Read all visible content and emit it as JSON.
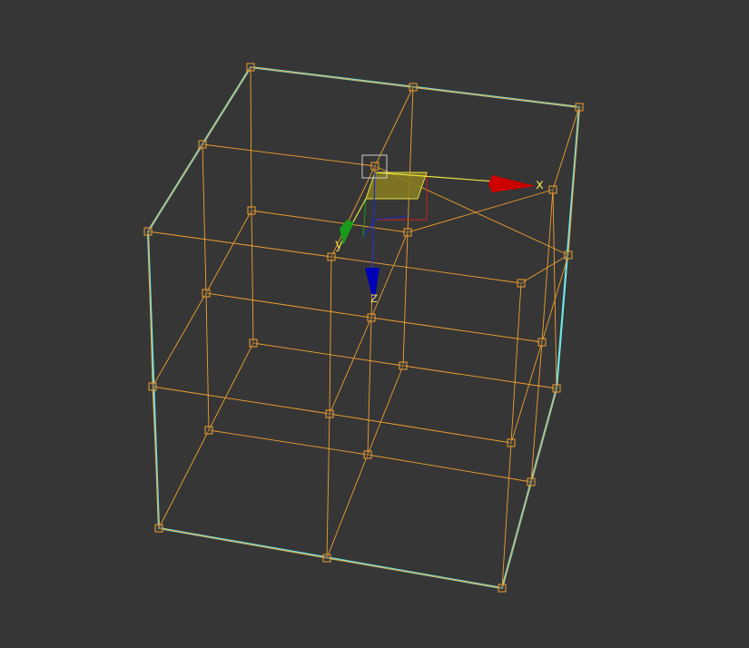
{
  "viewport": {
    "background": "#363636",
    "lattice_color": "#f0a030",
    "bounds_color": "#6fe4e8",
    "handle_fill": "#3a3a3a"
  },
  "gizmo": {
    "x_axis": {
      "label": "x",
      "color": "#cc0000"
    },
    "y_axis": {
      "label": "y",
      "color": "#1a9a1a"
    },
    "z_axis": {
      "label": "z",
      "color": "#0000b8"
    },
    "label_color": "#e8d84a",
    "plane_handle_color": "#b8a82a",
    "center_selector_color": "#cfcfcf",
    "icons": [
      "move-arrow-x-icon",
      "move-arrow-y-icon",
      "move-arrow-z-icon",
      "plane-handle-icon"
    ]
  }
}
